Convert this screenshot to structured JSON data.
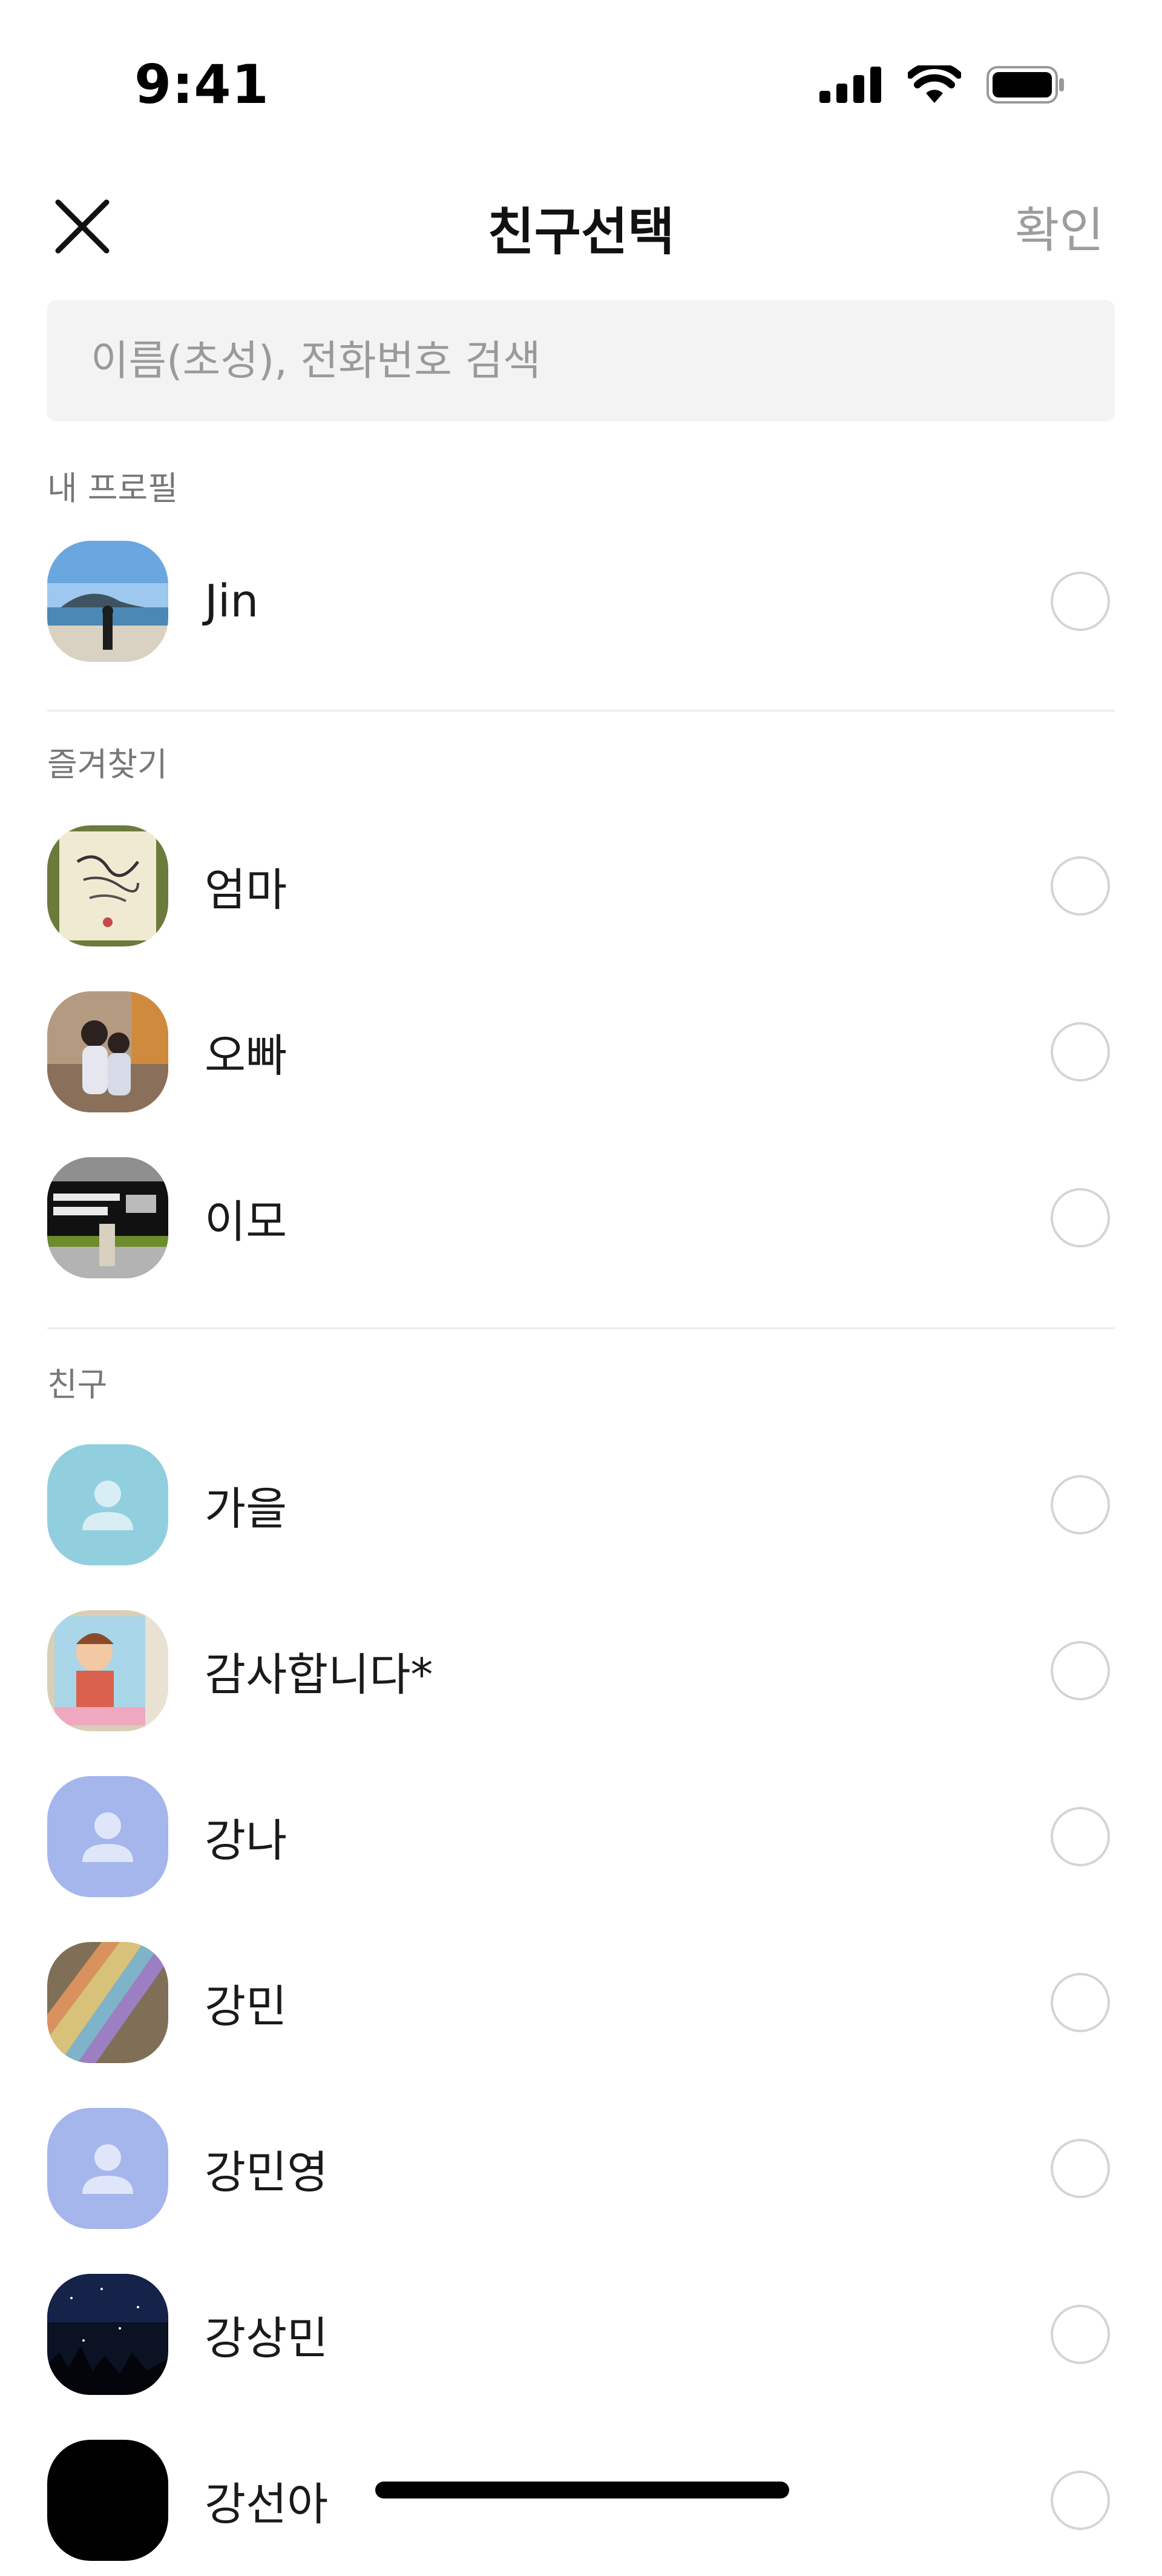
{
  "status_bar": {
    "time": "9:41"
  },
  "header": {
    "title": "친구선택",
    "confirm_label": "확인"
  },
  "search": {
    "placeholder": "이름(초성), 전화번호 검색"
  },
  "sections": {
    "my_profile": {
      "label": "내 프로필",
      "items": [
        {
          "name": "Jin",
          "avatar": "photo"
        }
      ]
    },
    "favorites": {
      "label": "즐겨찾기",
      "items": [
        {
          "name": "엄마",
          "avatar": "photo"
        },
        {
          "name": "오빠",
          "avatar": "photo"
        },
        {
          "name": "이모",
          "avatar": "photo"
        }
      ]
    },
    "friends": {
      "label": "친구",
      "items": [
        {
          "name": "가을",
          "avatar": "default-teal"
        },
        {
          "name": "감사합니다*",
          "avatar": "photo"
        },
        {
          "name": "강나",
          "avatar": "default-lavender"
        },
        {
          "name": "강민",
          "avatar": "photo"
        },
        {
          "name": "강민영",
          "avatar": "default-lavender"
        },
        {
          "name": "강상민",
          "avatar": "photo"
        },
        {
          "name": "강선아",
          "avatar": "photo"
        }
      ]
    }
  },
  "colors": {
    "accent_muted": "#9d9d9d",
    "search_bg": "#f3f3f3",
    "default_avatar_teal": "#92cfde",
    "default_avatar_lavender": "#a5b6ec",
    "radio_border": "#d4d4d4"
  },
  "icons": [
    "close-icon",
    "signal-icon",
    "wifi-icon",
    "battery-icon",
    "person-silhouette-icon"
  ]
}
